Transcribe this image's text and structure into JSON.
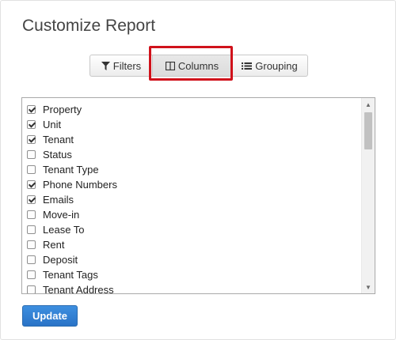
{
  "dialog": {
    "title": "Customize Report"
  },
  "tabs": [
    {
      "label": "Filters",
      "icon": "filter-icon"
    },
    {
      "label": "Columns",
      "icon": "columns-icon",
      "active": true
    },
    {
      "label": "Grouping",
      "icon": "list-icon"
    }
  ],
  "columns": [
    {
      "label": "Property",
      "checked": true
    },
    {
      "label": "Unit",
      "checked": true
    },
    {
      "label": "Tenant",
      "checked": true
    },
    {
      "label": "Status",
      "checked": false
    },
    {
      "label": "Tenant Type",
      "checked": false
    },
    {
      "label": "Phone Numbers",
      "checked": true
    },
    {
      "label": "Emails",
      "checked": true
    },
    {
      "label": "Move-in",
      "checked": false
    },
    {
      "label": "Lease To",
      "checked": false
    },
    {
      "label": "Rent",
      "checked": false
    },
    {
      "label": "Deposit",
      "checked": false
    },
    {
      "label": "Tenant Tags",
      "checked": false
    },
    {
      "label": "Tenant Address",
      "checked": false
    }
  ],
  "actions": {
    "update_label": "Update"
  },
  "colors": {
    "highlight": "#d0121b",
    "primary": "#2a73c7"
  }
}
